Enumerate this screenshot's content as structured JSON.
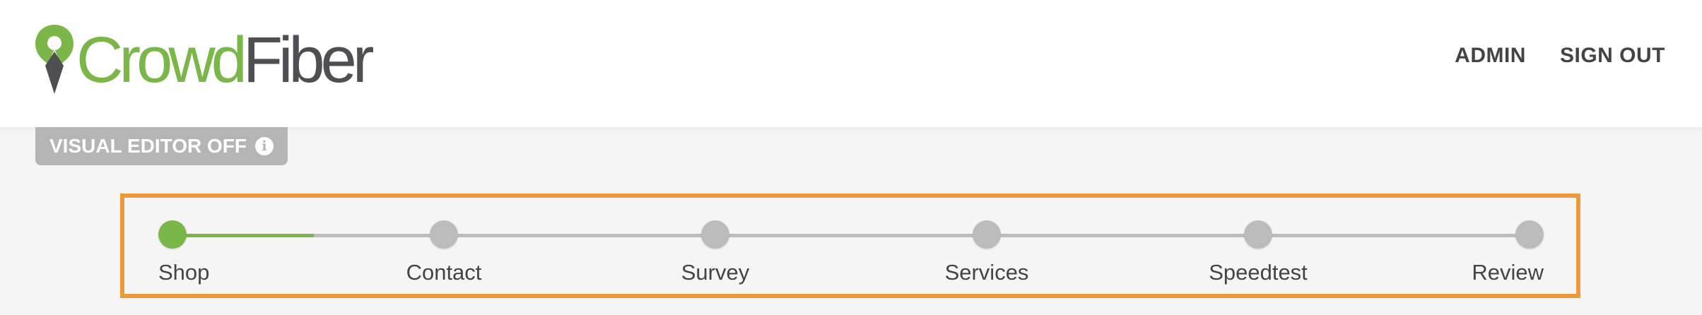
{
  "header": {
    "logo": {
      "part1": "Crowd",
      "part2": "Fiber",
      "green": "#7ab648",
      "gray": "#4d4f53"
    },
    "nav": [
      {
        "label": "ADMIN"
      },
      {
        "label": "SIGN OUT"
      }
    ]
  },
  "visual_editor": {
    "label": "VISUAL EDITOR OFF",
    "icon": "info-icon"
  },
  "progress": {
    "active_index": 0,
    "accent": "#7ab648",
    "inactive": "#bcbcbc",
    "highlight_border": "#ee9a3a",
    "steps": [
      {
        "label": "Shop"
      },
      {
        "label": "Contact"
      },
      {
        "label": "Survey"
      },
      {
        "label": "Services"
      },
      {
        "label": "Speedtest"
      },
      {
        "label": "Review"
      }
    ]
  }
}
